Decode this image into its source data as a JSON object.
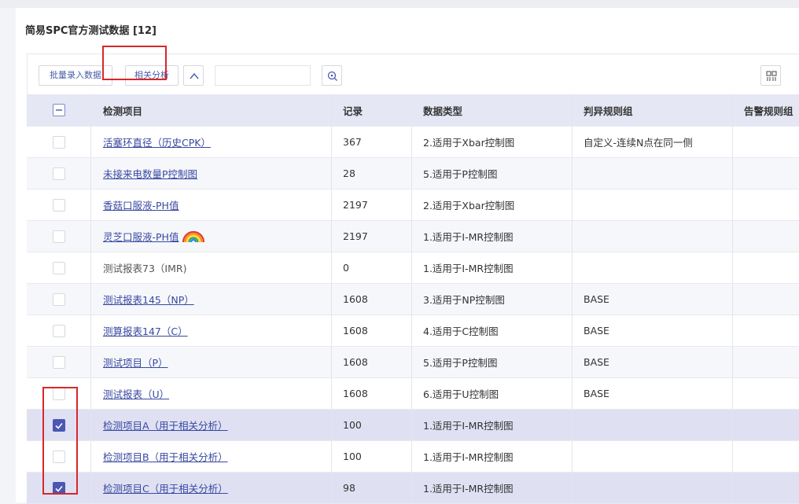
{
  "page": {
    "title": "简易SPC官方测试数据 [12]"
  },
  "toolbar": {
    "batch_label": "批量录入数据",
    "corr_label": "相关分析",
    "search_placeholder": ""
  },
  "table": {
    "columns": [
      "检测项目",
      "记录",
      "数据类型",
      "判异规则组",
      "告警规则组"
    ],
    "rows": [
      {
        "name": "活塞环直径（历史CPK）",
        "records": "367",
        "type": "2.适用于Xbar控制图",
        "rule": "自定义-连续N点在同一侧",
        "link": true,
        "checked": false
      },
      {
        "name": "未接来电数量P控制图",
        "records": "28",
        "type": "5.适用于P控制图",
        "rule": "",
        "link": true,
        "checked": false
      },
      {
        "name": "香菇口服液-PH值",
        "records": "2197",
        "type": "2.适用于Xbar控制图",
        "rule": "",
        "link": true,
        "checked": false
      },
      {
        "name": "灵芝口服液-PH值",
        "records": "2197",
        "type": "1.适用于I-MR控制图",
        "rule": "",
        "link": true,
        "checked": false,
        "rainbow": true
      },
      {
        "name": "测试报表73（IMR)",
        "records": "0",
        "type": "1.适用于I-MR控制图",
        "rule": "",
        "link": false,
        "checked": false
      },
      {
        "name": "测试报表145（NP）",
        "records": "1608",
        "type": "3.适用于NP控制图",
        "rule": "BASE",
        "link": true,
        "checked": false
      },
      {
        "name": "测算报表147（C）",
        "records": "1608",
        "type": "4.适用于C控制图",
        "rule": "BASE",
        "link": true,
        "checked": false
      },
      {
        "name": "测试项目（P）",
        "records": "1608",
        "type": "5.适用于P控制图",
        "rule": "BASE",
        "link": true,
        "checked": false
      },
      {
        "name": "测试报表（U）",
        "records": "1608",
        "type": "6.适用于U控制图",
        "rule": "BASE",
        "link": true,
        "checked": false
      },
      {
        "name": "检测项目A（用于相关分析）",
        "records": "100",
        "type": "1.适用于I-MR控制图",
        "rule": "",
        "link": true,
        "checked": true
      },
      {
        "name": "检测项目B（用于相关分析）",
        "records": "100",
        "type": "1.适用于I-MR控制图",
        "rule": "",
        "link": true,
        "checked": false
      },
      {
        "name": "检测项目C（用于相关分析）",
        "records": "98",
        "type": "1.适用于I-MR控制图",
        "rule": "",
        "link": true,
        "checked": true
      }
    ]
  },
  "colors": {
    "accent": "#4a57b3",
    "link": "#3848a0",
    "highlight": "#d9272b",
    "header_bg": "#e6e7f5"
  }
}
